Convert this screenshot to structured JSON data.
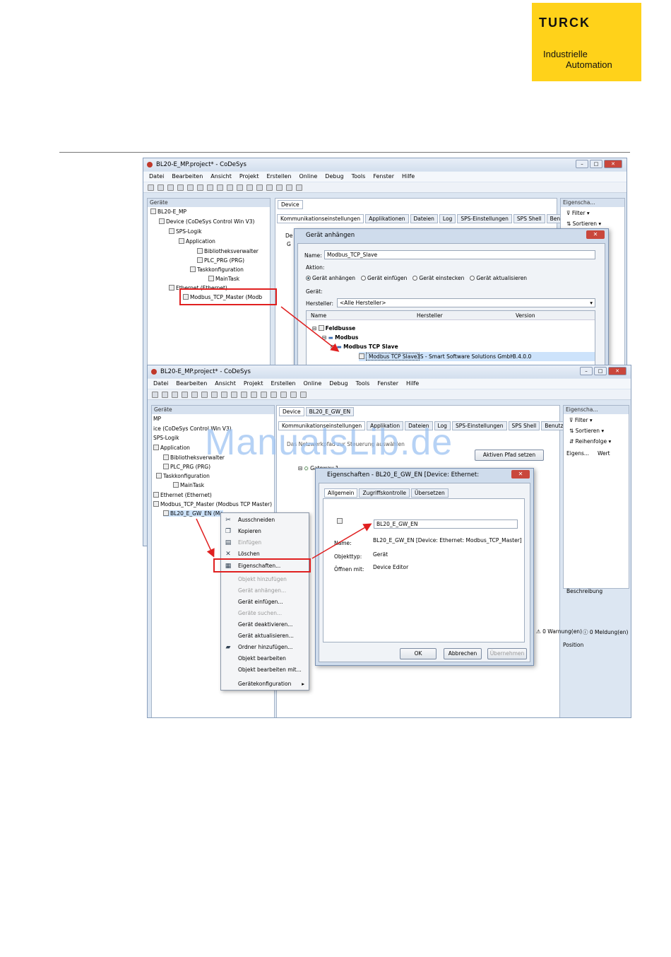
{
  "logo": {
    "brand": "TURCK",
    "line1": "Industrielle",
    "line2": "Automation",
    "color": "#ffd21a"
  },
  "watermark": "ManualsLib.de",
  "win1": {
    "title": "BL20-E_MP.project* - CoDeSys",
    "menu": [
      "Datei",
      "Bearbeiten",
      "Ansicht",
      "Projekt",
      "Erstellen",
      "Online",
      "Debug",
      "Tools",
      "Fenster",
      "Hilfe"
    ],
    "devices_header": "Geräte",
    "tree": [
      "BL20-E_MP",
      "Device (CoDeSys Control Win V3)",
      "SPS-Logik",
      "Application",
      "Bibliotheksverwalter",
      "PLC_PRG (PRG)",
      "Taskkonfiguration",
      "MainTask",
      "Ethernet (Ethernet)",
      "Modbus_TCP_Master (Modb"
    ],
    "editor_tab": "Device",
    "tabs": [
      "Kommunikationseinstellungen",
      "Applikationen",
      "Dateien",
      "Log",
      "SPS-Einstellungen",
      "SPS Shell",
      "Benutzer"
    ],
    "props_header": "Eigenscha...",
    "props_filter": "Filter",
    "props_sort": "Sortieren",
    "bg_left": "De",
    "bg_left2": "G"
  },
  "dlg1": {
    "title": "Gerät anhängen",
    "name_label": "Name:",
    "name_value": "Modbus_TCP_Slave",
    "aktion_label": "Aktion:",
    "radios": [
      "Gerät anhängen",
      "Gerät einfügen",
      "Gerät einstecken",
      "Gerät aktualisieren"
    ],
    "geraet_label": "Gerät:",
    "hersteller_label": "Hersteller:",
    "hersteller_value": "<Alle Hersteller>",
    "cols": [
      "Name",
      "Hersteller",
      "Version"
    ],
    "rows": [
      "Feldbusse",
      "Modbus",
      "Modbus TCP Slave"
    ],
    "sel_name": "Modbus TCP Slave",
    "sel_vendor": "3S - Smart Software Solutions GmbH",
    "sel_version": "3.4.0.0"
  },
  "win2": {
    "title": "BL20-E_MP.project* - CoDeSys",
    "menu": [
      "Datei",
      "Bearbeiten",
      "Ansicht",
      "Projekt",
      "Erstellen",
      "Online",
      "Debug",
      "Tools",
      "Fenster",
      "Hilfe"
    ],
    "devices_header": "Geräte",
    "tree": [
      "MP",
      "ice (CoDeSys Control Win V3)",
      "SPS-Logik",
      "Application",
      "Bibliotheksverwalter",
      "PLC_PRG (PRG)",
      "Taskkonfiguration",
      "MainTask",
      "Ethernet (Ethernet)",
      "Modbus_TCP_Master (Modbus TCP Master)",
      "BL20_E_GW_EN (Mo"
    ],
    "editor_tabs": [
      "Device",
      "BL20_E_GW_EN"
    ],
    "tabs": [
      "Kommunikationseinstellungen",
      "Applikation",
      "Dateien",
      "Log",
      "SPS-Einstellungen",
      "SPS Shell",
      "Benutzer"
    ],
    "network_label": "Das Netzwerkpfad zur Steuerung auswählen",
    "set_path_btn": "Aktiven Pfad setzen",
    "gateway": "Gateway-1",
    "props_header": "Eigenscha...",
    "props_filter": "Filter",
    "props_sort": "Sortieren",
    "props_order": "Reihenfolge",
    "props_cols": [
      "Eigens...",
      "Wert"
    ],
    "beschreibung": "Beschreibung",
    "warnings": "0 Warnung(en)",
    "messages": "0 Meldung(en)",
    "position": "Position"
  },
  "ctx": {
    "items": [
      {
        "label": "Ausschneiden",
        "icon": "✂",
        "disabled": false
      },
      {
        "label": "Kopieren",
        "icon": "❐",
        "disabled": false
      },
      {
        "label": "Einfügen",
        "icon": "▤",
        "disabled": true
      },
      {
        "label": "Löschen",
        "icon": "✕",
        "disabled": false
      },
      {
        "label": "Eigenschaften...",
        "icon": "▦",
        "disabled": false
      },
      {
        "label": "Objekt hinzufügen",
        "icon": "",
        "disabled": true
      },
      {
        "label": "Gerät anhängen...",
        "icon": "",
        "disabled": true
      },
      {
        "label": "Gerät einfügen...",
        "icon": "",
        "disabled": false
      },
      {
        "label": "Geräte suchen...",
        "icon": "",
        "disabled": true
      },
      {
        "label": "Gerät deaktivieren...",
        "icon": "",
        "disabled": false
      },
      {
        "label": "Gerät aktualisieren...",
        "icon": "",
        "disabled": false
      },
      {
        "label": "Ordner hinzufügen...",
        "icon": "▰",
        "disabled": false
      },
      {
        "label": "Objekt bearbeiten",
        "icon": "",
        "disabled": false
      },
      {
        "label": "Objekt bearbeiten mit...",
        "icon": "",
        "disabled": false
      },
      {
        "label": "Gerätekonfiguration",
        "icon": "",
        "disabled": false
      }
    ]
  },
  "dlg2": {
    "title": "Eigenschaften - BL20_E_GW_EN [Device: Ethernet: Modbus_TCP_Mast...",
    "tabs": [
      "Allgemein",
      "Zugriffskontrolle",
      "Übersetzen"
    ],
    "name_input": "BL20_E_GW_EN",
    "name_label": "Name:",
    "name_value": "BL20_E_GW_EN [Device: Ethernet: Modbus_TCP_Master]",
    "type_label": "Objekttyp:",
    "type_value": "Gerät",
    "open_label": "Öffnen mit:",
    "open_value": "Device Editor",
    "ok": "OK",
    "cancel": "Abbrechen",
    "apply": "Übernehmen"
  },
  "colors": {
    "highlight": "#e02020",
    "arrow": "#e02020"
  }
}
